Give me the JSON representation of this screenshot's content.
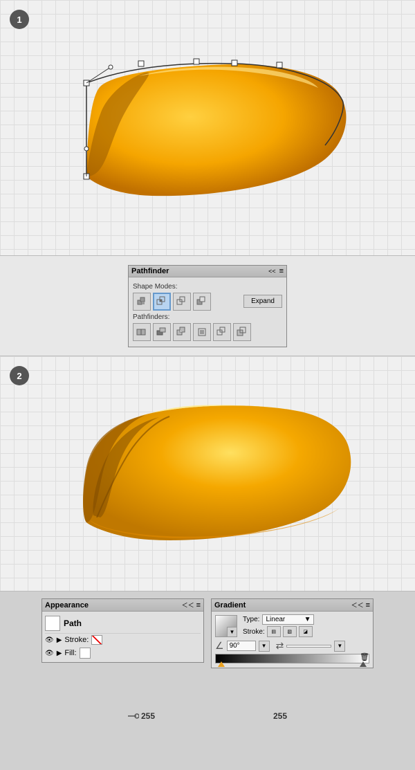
{
  "section1": {
    "step": "1",
    "description": "Canvas with path outline shape"
  },
  "section2": {
    "step": "2",
    "description": "Canvas with filled gradient shape"
  },
  "pathfinder": {
    "title": "Pathfinder",
    "shape_modes_label": "Shape Modes:",
    "pathfinders_label": "Pathfinders:",
    "expand_label": "Expand",
    "collapse_btn": "<<",
    "menu_btn": "≡"
  },
  "appearance": {
    "title": "Appearance",
    "path_label": "Path",
    "stroke_label": "Stroke:",
    "fill_label": "Fill:",
    "collapse_btn": "<<",
    "menu_btn": "≡"
  },
  "gradient": {
    "title": "Gradient",
    "type_label": "Type:",
    "type_value": "Linear",
    "stroke_label": "Stroke:",
    "angle_label": "90°",
    "collapse_btn": "<<",
    "menu_btn": "≡"
  },
  "bottom": {
    "left_value": "255",
    "right_value": "255"
  }
}
